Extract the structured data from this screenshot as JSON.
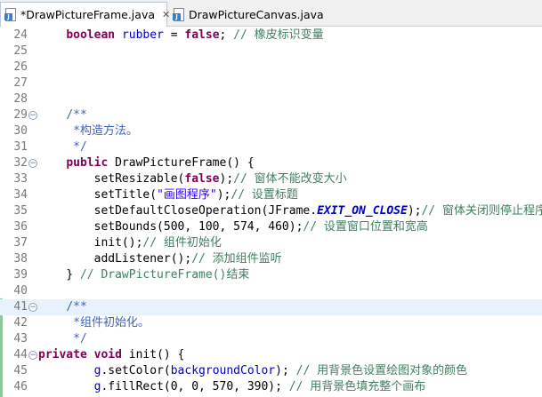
{
  "tabs": [
    {
      "label": "*DrawPictureFrame.java",
      "close": "✕",
      "active": true
    },
    {
      "label": "DrawPictureCanvas.java",
      "active": false
    }
  ],
  "editor": {
    "current_line": 41,
    "lines": [
      {
        "num": 24,
        "tokens": [
          {
            "t": "    "
          },
          {
            "t": "boolean",
            "c": "kw"
          },
          {
            "t": " "
          },
          {
            "t": "rubber",
            "c": "fld"
          },
          {
            "t": " = "
          },
          {
            "t": "false",
            "c": "kw"
          },
          {
            "t": "; "
          },
          {
            "t": "// 橡皮标识变量",
            "c": "cm"
          }
        ]
      },
      {
        "num": 25,
        "tokens": []
      },
      {
        "num": 26,
        "tokens": []
      },
      {
        "num": 27,
        "tokens": []
      },
      {
        "num": 28,
        "tokens": []
      },
      {
        "num": 29,
        "fold": "−",
        "tokens": [
          {
            "t": "    "
          },
          {
            "t": "/**",
            "c": "jd"
          }
        ]
      },
      {
        "num": 30,
        "tokens": [
          {
            "t": "     "
          },
          {
            "t": "*构造方法。",
            "c": "jd"
          }
        ]
      },
      {
        "num": 31,
        "tokens": [
          {
            "t": "     "
          },
          {
            "t": "*/",
            "c": "jd"
          }
        ]
      },
      {
        "num": 32,
        "fold": "−",
        "tokens": [
          {
            "t": "    "
          },
          {
            "t": "public",
            "c": "kw"
          },
          {
            "t": " DrawPictureFrame() {"
          }
        ]
      },
      {
        "num": 33,
        "tokens": [
          {
            "t": "        setResizable("
          },
          {
            "t": "false",
            "c": "kw"
          },
          {
            "t": ");"
          },
          {
            "t": "// 窗体不能改变大小",
            "c": "cm"
          }
        ]
      },
      {
        "num": 34,
        "tokens": [
          {
            "t": "        setTitle("
          },
          {
            "t": "\"画图程序\"",
            "c": "str"
          },
          {
            "t": ");"
          },
          {
            "t": "// 设置标题",
            "c": "cm"
          }
        ]
      },
      {
        "num": 35,
        "tokens": [
          {
            "t": "        setDefaultCloseOperation(JFrame."
          },
          {
            "t": "EXIT_ON_CLOSE",
            "c": "cst"
          },
          {
            "t": ");"
          },
          {
            "t": "// 窗体关闭则停止程序",
            "c": "cm"
          }
        ]
      },
      {
        "num": 36,
        "tokens": [
          {
            "t": "        setBounds(500, 100, 574, 460);"
          },
          {
            "t": "// 设置窗口位置和宽高",
            "c": "cm"
          }
        ]
      },
      {
        "num": 37,
        "tokens": [
          {
            "t": "        init();"
          },
          {
            "t": "// 组件初始化",
            "c": "cm"
          }
        ]
      },
      {
        "num": 38,
        "tokens": [
          {
            "t": "        addListener();"
          },
          {
            "t": "// 添加组件监听",
            "c": "cm"
          }
        ]
      },
      {
        "num": 39,
        "tokens": [
          {
            "t": "    } "
          },
          {
            "t": "// DrawPictureFrame()结束",
            "c": "cm"
          }
        ]
      },
      {
        "num": 40,
        "tokens": []
      },
      {
        "num": 41,
        "fold": "−",
        "tokens": [
          {
            "t": "    "
          },
          {
            "t": "/**",
            "c": "jd"
          }
        ]
      },
      {
        "num": 42,
        "tokens": [
          {
            "t": "     "
          },
          {
            "t": "*组件初始化。",
            "c": "jd"
          }
        ]
      },
      {
        "num": 43,
        "tokens": [
          {
            "t": "     "
          },
          {
            "t": "*/",
            "c": "jd"
          }
        ]
      },
      {
        "num": 44,
        "fold": "−",
        "tokens": [
          {
            "t": "private",
            "c": "kw"
          },
          {
            "t": " "
          },
          {
            "t": "void",
            "c": "kw"
          },
          {
            "t": " init() {"
          }
        ]
      },
      {
        "num": 45,
        "tokens": [
          {
            "t": "        "
          },
          {
            "t": "g",
            "c": "fld"
          },
          {
            "t": ".setColor("
          },
          {
            "t": "backgroundColor",
            "c": "fld"
          },
          {
            "t": "); "
          },
          {
            "t": "// 用背景色设置绘图对象的颜色",
            "c": "cm"
          }
        ]
      },
      {
        "num": 46,
        "tokens": [
          {
            "t": "        "
          },
          {
            "t": "g",
            "c": "fld"
          },
          {
            "t": ".fillRect(0, 0, 570, 390); "
          },
          {
            "t": "// 用背景色填充整个画布",
            "c": "cm"
          }
        ]
      }
    ]
  }
}
